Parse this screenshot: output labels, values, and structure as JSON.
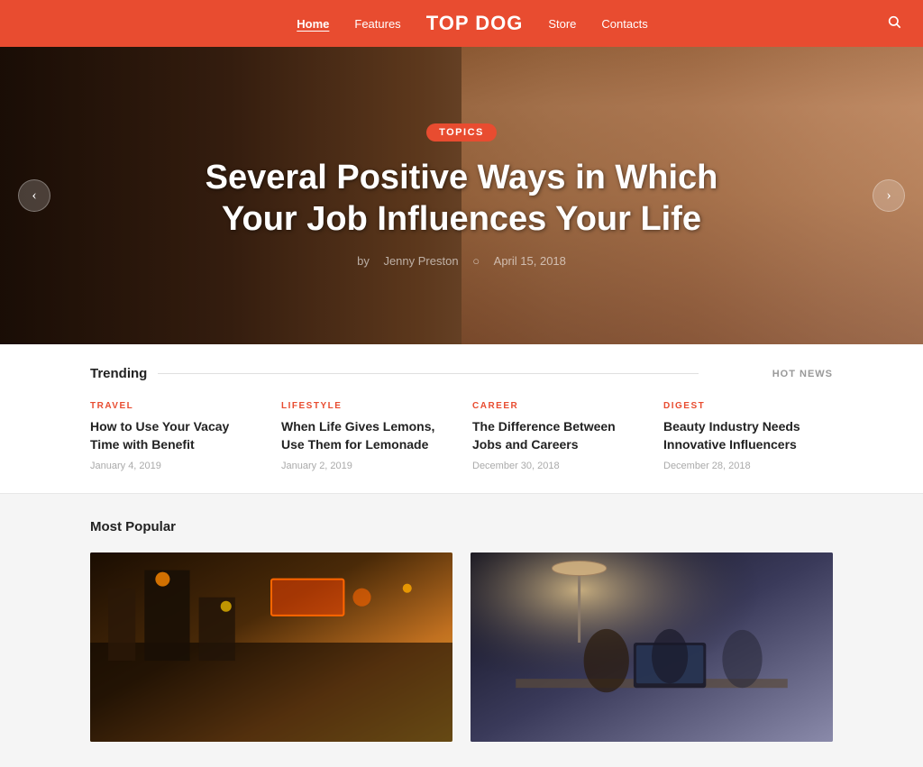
{
  "header": {
    "logo": "TOP DOG",
    "nav_items": [
      {
        "label": "Home",
        "active": true
      },
      {
        "label": "Features",
        "active": false
      },
      {
        "label": "Store",
        "active": false
      },
      {
        "label": "Contacts",
        "active": false
      }
    ],
    "search_icon": "🔍"
  },
  "hero": {
    "tag": "TOPICS",
    "title": "Several Positive Ways in Which Your Job Influences Your Life",
    "author": "Jenny Preston",
    "date": "April 15, 2018",
    "arrow_left": "‹",
    "arrow_right": "›"
  },
  "trending": {
    "title": "Trending",
    "hot_news_label": "HOT NEWS",
    "cards": [
      {
        "category": "TRAVEL",
        "title": "How to Use Your Vacay Time with Benefit",
        "date": "January 4, 2019"
      },
      {
        "category": "LIFESTYLE",
        "title": "When Life Gives Lemons, Use Them for Lemonade",
        "date": "January 2, 2019"
      },
      {
        "category": "CAREER",
        "title": "The Difference Between Jobs and Careers",
        "date": "December 30, 2018"
      },
      {
        "category": "DIGEST",
        "title": "Beauty Industry Needs Innovative Influencers",
        "date": "December 28, 2018"
      }
    ]
  },
  "most_popular": {
    "title": "Most Popular"
  }
}
